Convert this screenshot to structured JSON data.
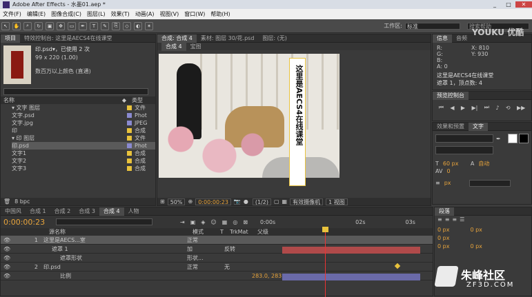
{
  "window_title": "Adobe After Effects - 水墨01.aep *",
  "menu": [
    "文件(F)",
    "编辑(E)",
    "图像合成(C)",
    "图层(L)",
    "效果(T)",
    "动画(A)",
    "视图(V)",
    "窗口(W)",
    "帮助(H)"
  ],
  "toolbar": {
    "workspace_label": "工作区:",
    "workspace_value": "标准",
    "search_placeholder": "搜索帮助"
  },
  "project": {
    "tabs": [
      "项目",
      "特效控制台: 这里是AECS4在线课堂"
    ],
    "item_name": "印.psd▾，已使用 2 次",
    "item_size": "99 x 220 (1.00)",
    "item_color": "数百万以上颜色 (直通)",
    "col_name": "名称",
    "col_type": "类型",
    "items": [
      {
        "name": "▾ 文字 图层",
        "type": "文件",
        "swatch": "#e8c23c"
      },
      {
        "name": "文字.psd",
        "type": "Phot",
        "swatch": "#8a8ad0"
      },
      {
        "name": "文字.jpg",
        "type": "JPEG",
        "swatch": "#8a8ad0"
      },
      {
        "name": "印",
        "type": "合成",
        "swatch": "#e8c23c"
      },
      {
        "name": "▾ 印 图层",
        "type": "文件",
        "swatch": "#e8c23c"
      },
      {
        "name": "印.psd",
        "type": "Phot",
        "swatch": "#8a8ad0"
      },
      {
        "name": "文字1",
        "type": "合成",
        "swatch": "#e8c23c"
      },
      {
        "name": "文字2",
        "type": "合成",
        "swatch": "#e8c23c"
      },
      {
        "name": "文字3",
        "type": "合成",
        "swatch": "#e8c23c"
      }
    ],
    "bpc": "8 bpc"
  },
  "comp": {
    "tabs": [
      "合成: 合成 4",
      "素材: 图层 30/花.psd",
      "图层: (无)"
    ],
    "subtabs": [
      "合成 4",
      "宝图"
    ],
    "overlay_text": "这里是AECS4在线课堂",
    "zoom": "50%",
    "timecode": "0:00:00:23",
    "resolution": "(1/2)",
    "camera": "有效摄像机",
    "views": "1 视图"
  },
  "info": {
    "tabs": [
      "信息",
      "音频"
    ],
    "rgb_labels": [
      "R:",
      "G:",
      "B:",
      "A: 0"
    ],
    "xy_labels": [
      "X: 810",
      "Y: 930"
    ],
    "line1": "这里是AECS4在线课堂",
    "line2": "遮罩 1，顶点数: 4"
  },
  "preview": {
    "tab": "预览控制台"
  },
  "char": {
    "tabs": [
      "效果和预置",
      "文字"
    ],
    "size": "60 px",
    "tracking": "自动",
    "vscale": "0",
    "unit": "px"
  },
  "paragraph": {
    "tab": "段落",
    "values": [
      "0 px",
      "0 px",
      "0 px",
      "0 px",
      "0 px"
    ]
  },
  "timeline": {
    "tabs": [
      "中国风",
      "合成 1",
      "合成 2",
      "合成 3",
      "合成 4",
      "人物"
    ],
    "timecode": "0:00:00:23",
    "ruler": [
      "0:00s",
      "02s",
      "03s"
    ],
    "cols": [
      "源名称",
      "模式",
      "T",
      "TrkMat",
      "父级"
    ],
    "rows": [
      {
        "num": "1",
        "name": "这里是AECS...室",
        "mode": "正常",
        "trk": "",
        "parent": "",
        "type": "layer"
      },
      {
        "num": "",
        "name": "遮罩 1",
        "mode": "加",
        "trk": "反转",
        "parent": "",
        "type": "mask"
      },
      {
        "num": "",
        "name": "遮罩形状",
        "mode": "形状...",
        "trk": "",
        "parent": "",
        "type": "prop"
      },
      {
        "num": "2",
        "name": "印.psd",
        "mode": "正常",
        "trk": "无",
        "parent": "",
        "type": "layer"
      },
      {
        "num": "",
        "name": "比例",
        "mode": "",
        "trk": "",
        "parent": "",
        "type": "prop",
        "value": "283.0, 283.0%"
      }
    ]
  },
  "watermarks": {
    "youku": "YOUKU 优酷",
    "zf3d": "朱峰社区",
    "zf3d_url": "ZF3D.COM"
  }
}
